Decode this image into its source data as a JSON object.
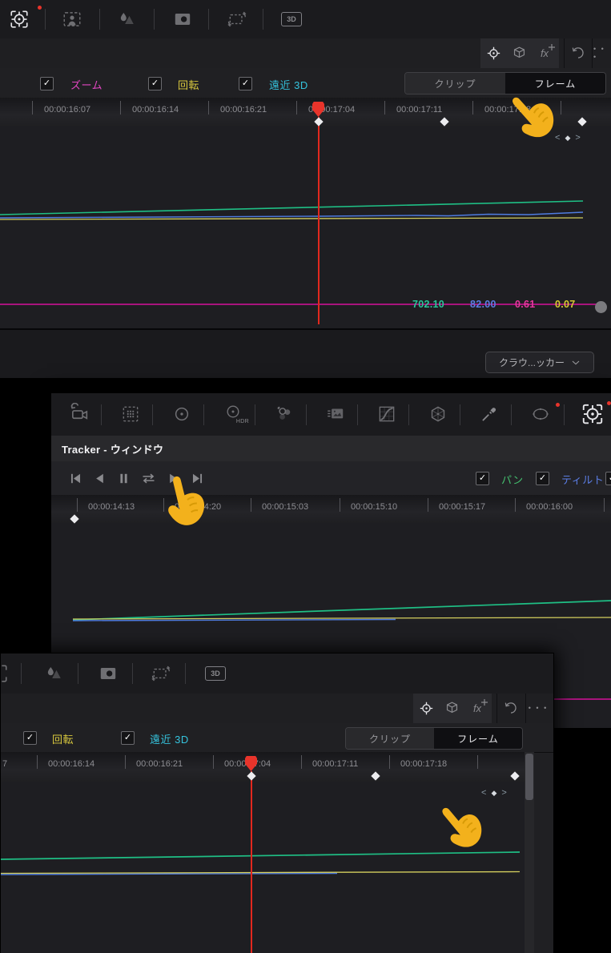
{
  "colors": {
    "playhead_red": "#e8342b",
    "magenta_line": "#d6119b",
    "green_line": "#1fbf85",
    "blue_line": "#4f7ce0",
    "yellow_line": "#d4cf5e",
    "hand_cursor": "#f3b11c"
  },
  "glyphs": {
    "check": "✓",
    "diamond": "◆",
    "nav_prev": "<",
    "nav_next": ">",
    "ellipsis": "• • •"
  },
  "icon_labels": {
    "threed": "3D",
    "hdr": "HDR",
    "fx": "fx"
  },
  "panel_top": {
    "toolbar_icons": [
      "tracker-window",
      "magic-mask",
      "blur-sharpen",
      "lens-correction",
      "stabilizer",
      "3d-tracker"
    ],
    "header_icons": [
      "tracker-target",
      "3d-cube",
      "effects-fx",
      "undo-history",
      "more-options"
    ],
    "checkboxes": [
      {
        "label": "ズーム",
        "color": "#e046c0",
        "checked": true
      },
      {
        "label": "回転",
        "color": "#d8c83e",
        "checked": true
      },
      {
        "label": "遠近 3D",
        "color": "#35c3dd",
        "checked": true
      }
    ],
    "view_switch": {
      "clip": "クリップ",
      "frame": "フレーム",
      "selected": "フレーム"
    },
    "ruler_labels": [
      "00:00:16:07",
      "00:00:16:14",
      "00:00:16:21",
      "00:00:17:04",
      "00:00:17:11",
      "00:00:17:18"
    ],
    "graph_values": [
      {
        "text": "702.10",
        "color": "#2ac49a"
      },
      {
        "text": "82.00",
        "color": "#5b7de4"
      },
      {
        "text": "0.61",
        "color": "#e8389f"
      },
      {
        "text": "0.07",
        "color": "#d8c832"
      }
    ],
    "tracker_mode_dropdown": "クラウ...ッカー"
  },
  "panel_middle": {
    "toolbar_icons": [
      "camera-tracker",
      "grid-sizing",
      "color-wheels",
      "hdr-grade",
      "color-balls",
      "stills-adjust",
      "custom-curves",
      "color-warper",
      "qualifier",
      "power-window",
      "tracker-window"
    ],
    "window_title": "Tracker - ウィンドウ",
    "transport": [
      "go-to-start",
      "play-reverse",
      "pause",
      "track-bidirectional",
      "play-forward",
      "go-to-end"
    ],
    "checkboxes": [
      {
        "label": "パン",
        "color": "#44bf6e",
        "checked": true
      },
      {
        "label": "ティルト",
        "color": "#5b7de4",
        "checked": true
      },
      {
        "label": "",
        "color": "#8a8a8e",
        "checked": true
      }
    ],
    "ruler_labels": [
      "00:00:14:13",
      "00:00:14:20",
      "00:00:15:03",
      "00:00:15:10",
      "00:00:15:17",
      "00:00:16:00"
    ]
  },
  "panel_bottom": {
    "toolbar_icons": [
      "blur-sharpen",
      "lens-correction",
      "stabilizer",
      "3d-tracker"
    ],
    "header_icons": [
      "tracker-target",
      "3d-cube",
      "effects-fx",
      "undo-history",
      "more-options"
    ],
    "checkboxes": [
      {
        "label": "回転",
        "color": "#d8c83e",
        "checked": true
      },
      {
        "label": "遠近 3D",
        "color": "#35c3dd",
        "checked": true
      }
    ],
    "view_switch": {
      "clip": "クリップ",
      "frame": "フレーム",
      "selected": "フレーム"
    },
    "ruler_partial_label": "7",
    "ruler_labels": [
      "00:00:16:14",
      "00:00:16:21",
      "00:00:17:04",
      "00:00:17:11",
      "00:00:17:18"
    ]
  }
}
